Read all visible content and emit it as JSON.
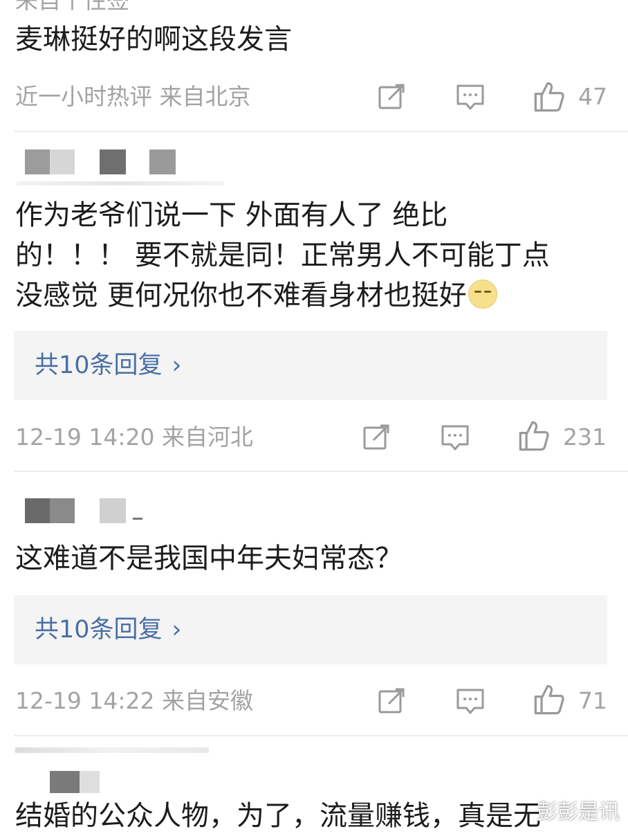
{
  "comments": [
    {
      "lines": [
        "麦琳挺好的啊这段发言"
      ],
      "meta": "近一小时热评  来自北京",
      "likes": "47"
    },
    {
      "lines": [
        "作为老爷们说一下 外面有人了 绝比",
        "的！！！ 要不就是同！正常男人不可能丁点",
        "没感觉 更何况你也不难看身材也挺好"
      ],
      "emoji": "emoji-face-icon",
      "replies": "共10条回复",
      "meta": "12-19 14:20  来自河北",
      "likes": "231"
    },
    {
      "lines": [
        "这难道不是我国中年夫妇常态？"
      ],
      "replies": "共10条回复",
      "meta": "12-19 14:22  来自安徽",
      "likes": "71"
    },
    {
      "lines": [
        "结婚的公众人物，为了，流量赚钱，真是无"
      ]
    }
  ],
  "top_partial_text": "来自个性签",
  "reply_chevron": "›",
  "watermark": "彭彭是讯",
  "colors": {
    "meta": "#a3a3a3",
    "reply_link": "#4a6fa5",
    "reply_bg": "#f4f4f4",
    "divider": "#ececec"
  }
}
